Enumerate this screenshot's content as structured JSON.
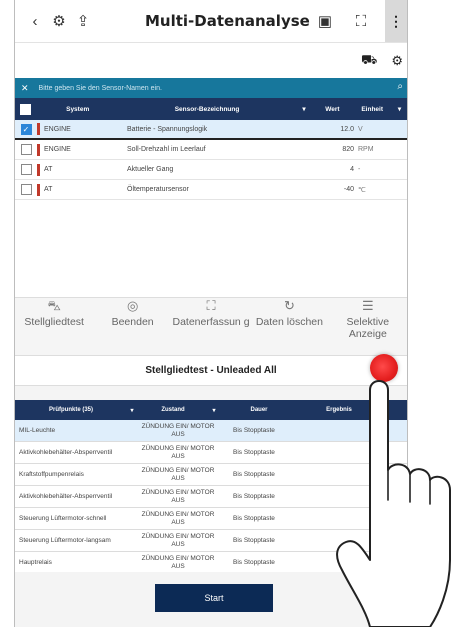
{
  "header": {
    "title": "Multi-Datenanalyse",
    "back_icon": "chevron-left-icon",
    "icons": [
      "settings-icon",
      "export-icon",
      "vehicle-icon",
      "fullscreen-icon",
      "more-vert-icon"
    ]
  },
  "search": {
    "placeholder": "Bitte geben Sie den Sensor-Namen ein."
  },
  "sensor_table": {
    "columns": [
      "System",
      "Sensor-Bezeichnung",
      "Wert",
      "Einheit"
    ],
    "rows": [
      {
        "system": "ENGINE",
        "name": "Batterie - Spannungslogik",
        "value": "12.0",
        "unit": "V",
        "checked": true
      },
      {
        "system": "ENGINE",
        "name": "Soll-Drehzahl im Leerlauf",
        "value": "820",
        "unit": "RPM",
        "checked": false
      },
      {
        "system": "AT",
        "name": "Aktueller Gang",
        "value": "4",
        "unit": "-",
        "checked": false
      },
      {
        "system": "AT",
        "name": "Öltemperatursensor",
        "value": "-40",
        "unit": "℃",
        "checked": false
      }
    ]
  },
  "actions": {
    "stellgliedtest": "Stellgliedtest",
    "beenden": "Beenden",
    "datenerfassung": "Datenerfassun g",
    "daten_loeschen": "Daten löschen",
    "selektive_anzeige": "Selektive Anzeige"
  },
  "panel": {
    "title": "Stellgliedtest - Unleaded All",
    "columns": [
      "Prüfpunkte (35)",
      "Zustand",
      "Dauer",
      "Ergebnis"
    ],
    "rows": [
      {
        "name": "MIL-Leuchte",
        "state": "ZÜNDUNG EIN/ MOTOR AUS",
        "duration": "Bis Stopptaste",
        "result": ""
      },
      {
        "name": "Aktivkohlebehälter-Absperrventil",
        "state": "ZÜNDUNG EIN/ MOTOR AUS",
        "duration": "Bis Stopptaste",
        "result": ""
      },
      {
        "name": "Kraftstoffpumpenrelais",
        "state": "ZÜNDUNG EIN/ MOTOR AUS",
        "duration": "Bis Stopptaste",
        "result": ""
      },
      {
        "name": "Aktivkohlebehälter-Absperrventil",
        "state": "ZÜNDUNG EIN/ MOTOR AUS",
        "duration": "Bis Stopptaste",
        "result": ""
      },
      {
        "name": "Steuerung Lüftermotor-schnell",
        "state": "ZÜNDUNG EIN/ MOTOR AUS",
        "duration": "Bis Stopptaste",
        "result": ""
      },
      {
        "name": "Steuerung Lüftermotor-langsam",
        "state": "ZÜNDUNG EIN/ MOTOR AUS",
        "duration": "Bis Stopptaste",
        "result": ""
      },
      {
        "name": "Hauptrelais",
        "state": "ZÜNDUNG EIN/ MOTOR AUS",
        "duration": "Bis Stopptaste",
        "result": ""
      }
    ],
    "start_label": "Start"
  },
  "colors": {
    "header_navy": "#1d3560",
    "search_teal": "#17779c",
    "accent_red": "#c0392b",
    "button_navy": "#0c2a55",
    "touch_dot": "#e41f1f"
  }
}
